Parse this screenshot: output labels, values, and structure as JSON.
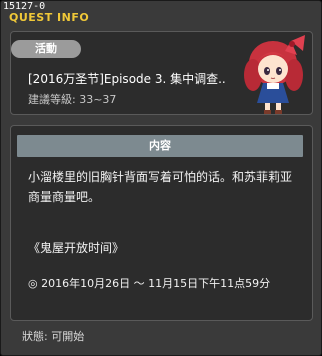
{
  "header": {
    "id": "15127-0",
    "title": "QUEST INFO"
  },
  "quest": {
    "badge": "活動",
    "name": "[2016万圣节]Episode 3. 集中调查..",
    "level": "建議等級: 33~37"
  },
  "content": {
    "heading": "内容",
    "description": "小溜楼里的旧胸针背面写着可怕的话。和苏菲莉亚商量商量吧。",
    "event": "《鬼屋开放时间》",
    "date_line": "◎ 2016年10月26日 ～ 11月15日下午11点59分"
  },
  "status": {
    "text": "狀態: 可開始"
  },
  "colors": {
    "title": "#f0c838",
    "badge_bg": "#9b9b9b",
    "section_bg": "#7d8a90"
  }
}
